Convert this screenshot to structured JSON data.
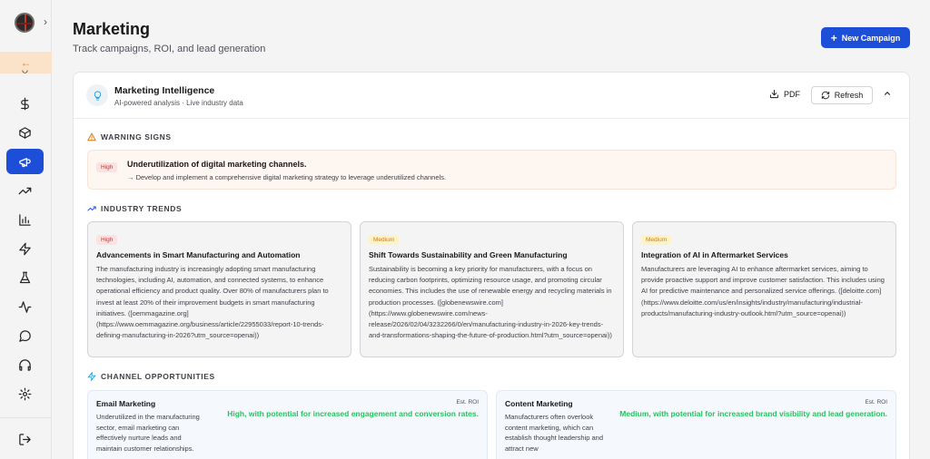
{
  "header": {
    "title": "Marketing",
    "subtitle": "Track campaigns, ROI, and lead generation",
    "new_campaign_label": "New Campaign"
  },
  "sidebar": {
    "back_icon": "arrow-left-icon",
    "items": [
      {
        "icon": "dollar-icon",
        "active": false
      },
      {
        "icon": "box-icon",
        "active": false
      },
      {
        "icon": "megaphone-icon",
        "active": true
      },
      {
        "icon": "trending-up-icon",
        "active": false
      },
      {
        "icon": "bar-chart-icon",
        "active": false
      },
      {
        "icon": "zap-icon",
        "active": false
      },
      {
        "icon": "flask-icon",
        "active": false
      },
      {
        "icon": "activity-icon",
        "active": false
      },
      {
        "icon": "message-icon",
        "active": false
      },
      {
        "icon": "headphones-icon",
        "active": false
      },
      {
        "icon": "gear-icon",
        "active": false
      }
    ],
    "logout_icon": "logout-icon"
  },
  "intel": {
    "title": "Marketing Intelligence",
    "subtitle": "AI-powered analysis · Live industry data",
    "pdf_label": "PDF",
    "refresh_label": "Refresh"
  },
  "warnings": {
    "label": "WARNING SIGNS",
    "items": [
      {
        "priority": "High",
        "title": "Underutilization of digital marketing channels.",
        "action": "→ Develop and implement a comprehensive digital marketing strategy to leverage underutilized channels."
      }
    ]
  },
  "trends": {
    "label": "INDUSTRY TRENDS",
    "items": [
      {
        "priority": "High",
        "title": "Advancements in Smart Manufacturing and Automation",
        "body": "The manufacturing industry is increasingly adopting smart manufacturing technologies, including AI, automation, and connected systems, to enhance operational efficiency and product quality. Over 80% of manufacturers plan to invest at least 20% of their improvement budgets in smart manufacturing initiatives. ([oemmagazine.org](https://www.oemmagazine.org/business/article/22955033/report-10-trends-defining-manufacturing-in-2026?utm_source=openai))"
      },
      {
        "priority": "Medium",
        "title": "Shift Towards Sustainability and Green Manufacturing",
        "body": "Sustainability is becoming a key priority for manufacturers, with a focus on reducing carbon footprints, optimizing resource usage, and promoting circular economies. This includes the use of renewable energy and recycling materials in production processes. ([globenewswire.com](https://www.globenewswire.com/news-release/2026/02/04/3232266/0/en/manufacturing-industry-in-2026-key-trends-and-transformations-shaping-the-future-of-production.html?utm_source=openai))"
      },
      {
        "priority": "Medium",
        "title": "Integration of AI in Aftermarket Services",
        "body": "Manufacturers are leveraging AI to enhance aftermarket services, aiming to provide proactive support and improve customer satisfaction. This includes using AI for predictive maintenance and personalized service offerings. ([deloitte.com](https://www.deloitte.com/us/en/insights/industry/manufacturing/industrial-products/manufacturing-industry-outlook.html?utm_source=openai))"
      }
    ]
  },
  "channels": {
    "label": "CHANNEL OPPORTUNITIES",
    "roi_label": "Est. ROI",
    "items": [
      {
        "name": "Email Marketing",
        "description": "Underutilized in the manufacturing sector, email marketing can effectively nurture leads and maintain customer relationships.",
        "roi": "High, with potential for increased engagement and conversion rates."
      },
      {
        "name": "Content Marketing",
        "description": "Manufacturers often overlook content marketing, which can establish thought leadership and attract new",
        "roi": "Medium, with potential for increased brand visibility and lead generation."
      }
    ]
  }
}
